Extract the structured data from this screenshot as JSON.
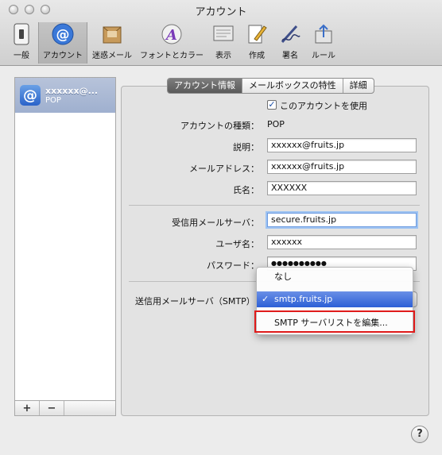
{
  "window": {
    "title": "アカウント"
  },
  "toolbar": {
    "items": [
      {
        "label": "一般",
        "icon": "switch-icon"
      },
      {
        "label": "アカウント",
        "icon": "at-sign-icon"
      },
      {
        "label": "迷惑メール",
        "icon": "junk-mail-icon"
      },
      {
        "label": "フォントとカラー",
        "icon": "font-color-icon"
      },
      {
        "label": "表示",
        "icon": "display-icon"
      },
      {
        "label": "作成",
        "icon": "compose-icon"
      },
      {
        "label": "署名",
        "icon": "signature-icon"
      },
      {
        "label": "ルール",
        "icon": "rules-icon"
      }
    ]
  },
  "sidebar": {
    "account": {
      "name": "xxxxxx@...",
      "type": "POP"
    },
    "add_label": "+",
    "remove_label": "−"
  },
  "tabs": [
    "アカウント情報",
    "メールボックスの特性",
    "詳細"
  ],
  "form": {
    "enable_checkbox_label": "このアカウントを使用",
    "account_type_label": "アカウントの種類：",
    "account_type_value": "POP",
    "description_label": "説明：",
    "description_value": "xxxxxx@fruits.jp",
    "email_label": "メールアドレス：",
    "email_value": "xxxxxx@fruits.jp",
    "name_label": "氏名：",
    "name_value": "XXXXXX",
    "incoming_label": "受信用メールサーバ：",
    "incoming_value": "secure.fruits.jp",
    "username_label": "ユーザ名：",
    "username_value": "xxxxxx",
    "password_label": "パスワード：",
    "password_value": "●●●●●●●●●●",
    "smtp_label": "送信用メールサーバ（SMTP）"
  },
  "smtp_menu": {
    "items": [
      "なし",
      "smtp.fruits.jp",
      "SMTP サーバリストを編集..."
    ],
    "selected_check": "✓"
  },
  "help_label": "?"
}
